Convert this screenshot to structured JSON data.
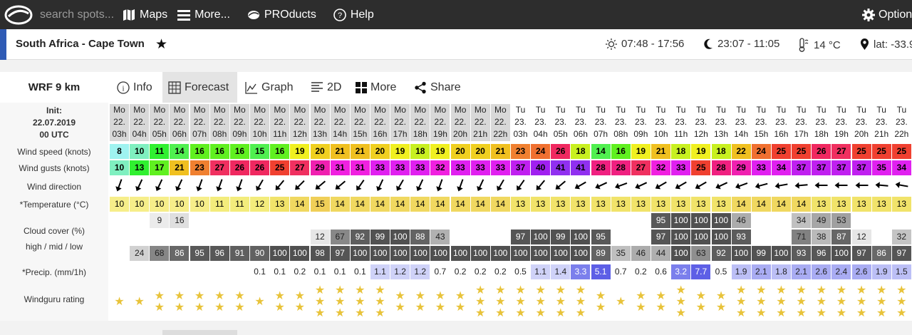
{
  "topbar": {
    "search_placeholder": "search spots...",
    "maps_label": "Maps",
    "more_label": "More...",
    "products_label": "PROducts",
    "help_label": "Help",
    "options_label": "Option"
  },
  "location": {
    "title": "South Africa - Cape Town",
    "sun": "07:48 - 17:56",
    "moon": "23:07 - 11:05",
    "temp": "14 °C",
    "lat": "lat: -33.9"
  },
  "model": {
    "name": "WRF 9 km",
    "tabs": [
      "Info",
      "Forecast",
      "Graph",
      "2D",
      "More",
      "Share"
    ]
  },
  "left_labels": {
    "init_title": "Init:",
    "init_date": "22.07.2019",
    "init_utc": "00 UTC",
    "wind_speed": "Wind speed (knots)",
    "wind_gusts": "Wind gusts (knots)",
    "wind_dir": "Wind direction",
    "temperature": "*Temperature (°C)",
    "cloud_cover": "Cloud cover (%)",
    "cloud_levels": "high / mid / low",
    "precip": "*Precip. (mm/1h)",
    "rating": "Windguru rating"
  },
  "colors": {
    "topbar": "#2d2d2d",
    "accent": "#2f5bb5",
    "star": "#e8c33a"
  },
  "forecast": {
    "days": [
      "Mo",
      "Mo",
      "Mo",
      "Mo",
      "Mo",
      "Mo",
      "Mo",
      "Mo",
      "Mo",
      "Mo",
      "Mo",
      "Mo",
      "Mo",
      "Mo",
      "Mo",
      "Mo",
      "Mo",
      "Mo",
      "Mo",
      "Mo",
      "Tu",
      "Tu",
      "Tu",
      "Tu",
      "Tu",
      "Tu",
      "Tu",
      "Tu",
      "Tu",
      "Tu",
      "Tu",
      "Tu",
      "Tu",
      "Tu",
      "Tu",
      "Tu",
      "Tu",
      "Tu",
      "Tu",
      "Tu"
    ],
    "dates": [
      "22.",
      "22.",
      "22.",
      "22.",
      "22.",
      "22.",
      "22.",
      "22.",
      "22.",
      "22.",
      "22.",
      "22.",
      "22.",
      "22.",
      "22.",
      "22.",
      "22.",
      "22.",
      "22.",
      "22.",
      "23.",
      "23.",
      "23.",
      "23.",
      "23.",
      "23.",
      "23.",
      "23.",
      "23.",
      "23.",
      "23.",
      "23.",
      "23.",
      "23.",
      "23.",
      "23.",
      "23.",
      "23.",
      "23.",
      "23."
    ],
    "hours": [
      "03h",
      "04h",
      "05h",
      "06h",
      "07h",
      "08h",
      "09h",
      "10h",
      "11h",
      "12h",
      "13h",
      "14h",
      "15h",
      "16h",
      "17h",
      "18h",
      "19h",
      "20h",
      "21h",
      "22h",
      "03h",
      "04h",
      "05h",
      "06h",
      "07h",
      "08h",
      "09h",
      "10h",
      "11h",
      "12h",
      "13h",
      "14h",
      "15h",
      "16h",
      "17h",
      "18h",
      "19h",
      "20h",
      "21h",
      "22h"
    ],
    "wind_speed": [
      "8",
      "10",
      "11",
      "14",
      "16",
      "16",
      "16",
      "15",
      "16",
      "19",
      "20",
      "21",
      "21",
      "20",
      "19",
      "18",
      "19",
      "20",
      "20",
      "21",
      "23",
      "24",
      "26",
      "18",
      "14",
      "16",
      "19",
      "21",
      "18",
      "19",
      "18",
      "22",
      "24",
      "25",
      "25",
      "26",
      "27",
      "25",
      "25",
      "25"
    ],
    "wind_gusts": [
      "10",
      "13",
      "17",
      "21",
      "23",
      "27",
      "26",
      "26",
      "25",
      "27",
      "29",
      "31",
      "31",
      "33",
      "33",
      "33",
      "32",
      "33",
      "33",
      "33",
      "37",
      "40",
      "41",
      "41",
      "28",
      "28",
      "27",
      "32",
      "33",
      "25",
      "28",
      "29",
      "33",
      "34",
      "37",
      "37",
      "37",
      "37",
      "35",
      "34"
    ],
    "wind_dir_deg": [
      200,
      205,
      205,
      205,
      200,
      200,
      200,
      210,
      220,
      225,
      230,
      230,
      215,
      205,
      210,
      205,
      200,
      200,
      205,
      210,
      215,
      220,
      230,
      240,
      245,
      250,
      245,
      240,
      240,
      240,
      245,
      250,
      255,
      260,
      265,
      270,
      270,
      270,
      275,
      280
    ],
    "temperature": [
      "10",
      "10",
      "10",
      "10",
      "10",
      "11",
      "11",
      "12",
      "13",
      "14",
      "15",
      "14",
      "14",
      "14",
      "14",
      "14",
      "14",
      "14",
      "14",
      "14",
      "13",
      "13",
      "13",
      "13",
      "13",
      "13",
      "13",
      "13",
      "13",
      "13",
      "13",
      "14",
      "14",
      "14",
      "14",
      "13",
      "13",
      "13",
      "13",
      "13"
    ],
    "cloud_high": [
      "",
      "",
      "9",
      "16",
      "",
      "",
      "",
      "",
      "",
      "",
      "",
      "",
      "",
      "",
      "",
      "",
      "",
      "",
      "",
      "",
      "",
      "",
      "",
      "",
      "",
      "",
      "",
      "95",
      "100",
      "100",
      "100",
      "46",
      "",
      "",
      "34",
      "49",
      "53",
      "",
      "",
      ""
    ],
    "cloud_mid": [
      "",
      "",
      "",
      "",
      "",
      "",
      "",
      "",
      "",
      "",
      "12",
      "67",
      "92",
      "99",
      "100",
      "88",
      "43",
      "",
      "",
      "",
      "97",
      "100",
      "99",
      "100",
      "95",
      "",
      "",
      "97",
      "100",
      "100",
      "100",
      "93",
      "",
      "",
      "71",
      "38",
      "87",
      "12",
      "",
      "32"
    ],
    "cloud_low": [
      "",
      "24",
      "68",
      "86",
      "95",
      "96",
      "91",
      "90",
      "100",
      "100",
      "98",
      "97",
      "100",
      "100",
      "100",
      "100",
      "100",
      "100",
      "100",
      "100",
      "100",
      "100",
      "100",
      "100",
      "89",
      "35",
      "46",
      "44",
      "100",
      "63",
      "92",
      "100",
      "99",
      "100",
      "93",
      "96",
      "100",
      "97",
      "86",
      "97"
    ],
    "precip": [
      "",
      "",
      "",
      "",
      "",
      "",
      "",
      "0.1",
      "0.1",
      "0.2",
      "0.1",
      "0.1",
      "0.1",
      "1.1",
      "1.2",
      "1.2",
      "0.7",
      "0.2",
      "0.2",
      "0.2",
      "0.5",
      "1.1",
      "1.4",
      "3.3",
      "5.1",
      "0.7",
      "0.2",
      "0.6",
      "3.2",
      "7.7",
      "0.5",
      "1.9",
      "2.1",
      "1.8",
      "2.1",
      "2.6",
      "2.4",
      "2.6",
      "1.9",
      "1.5"
    ],
    "rating": [
      1,
      1,
      2,
      2,
      2,
      2,
      2,
      1,
      2,
      2,
      3,
      3,
      3,
      3,
      2,
      2,
      2,
      2,
      3,
      3,
      3,
      3,
      3,
      3,
      2,
      1,
      2,
      2,
      3,
      2,
      2,
      3,
      3,
      3,
      3,
      3,
      3,
      3,
      3,
      3
    ]
  }
}
